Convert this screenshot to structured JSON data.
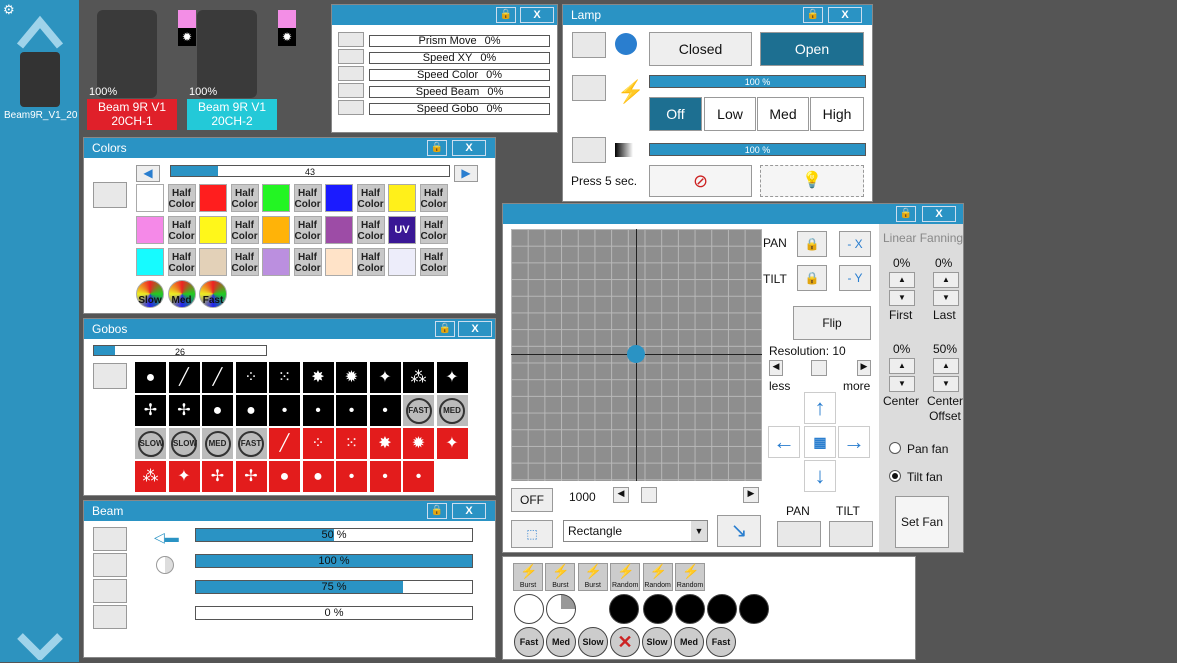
{
  "sidebar": {
    "device_label": "Beam9R_V1_20"
  },
  "fixtures": [
    {
      "name": "Beam 9R V1",
      "mode": "20CH-1",
      "percent": "100%"
    },
    {
      "name": "Beam 9R V1",
      "mode": "20CH-2",
      "percent": "100%"
    }
  ],
  "speeds": {
    "items": [
      {
        "label": "Prism Move",
        "value": "0%"
      },
      {
        "label": "Speed XY",
        "value": "0%"
      },
      {
        "label": "Speed Color",
        "value": "0%"
      },
      {
        "label": "Speed Beam",
        "value": "0%"
      },
      {
        "label": "Speed Gobo",
        "value": "0%"
      }
    ]
  },
  "lamp": {
    "title": "Lamp",
    "closed": "Closed",
    "open": "Open",
    "bar1": "100 %",
    "bar2": "100 %",
    "off": "Off",
    "low": "Low",
    "med": "Med",
    "high": "High",
    "press": "Press 5 sec."
  },
  "colors": {
    "title": "Colors",
    "value": "43",
    "half": "Half Color",
    "uv": "UV",
    "slow": "Slow",
    "med": "Med",
    "fast": "Fast",
    "value_fraction": 0.25
  },
  "gobos": {
    "title": "Gobos",
    "value": "26",
    "value_fraction": 0.12,
    "fast": "FAST",
    "med": "MED",
    "slow": "SLOW"
  },
  "beam": {
    "title": "Beam",
    "bars": [
      {
        "text": "50 %",
        "fraction": 0.5
      },
      {
        "text": "100 %",
        "fraction": 1.0
      },
      {
        "text": "75 %",
        "fraction": 0.75
      },
      {
        "text": "0 %",
        "fraction": 0.0
      }
    ]
  },
  "position": {
    "pan": "PAN",
    "tilt": "TILT",
    "neg_x": "- X",
    "neg_y": "- Y",
    "flip": "Flip",
    "resolution": "Resolution: 10",
    "less": "less",
    "more": "more",
    "off": "OFF",
    "speed_value": "1000",
    "shape": "Rectangle",
    "pan_bottom": "PAN",
    "tilt_bottom": "TILT",
    "linear_fanning": "Linear Fanning",
    "first_val": "0%",
    "last_val": "0%",
    "first": "First",
    "last": "Last",
    "center_val": "0%",
    "offset_val": "50%",
    "center": "Center",
    "center_offset": "Center Offset",
    "pan_fan": "Pan fan",
    "tilt_fan": "Tilt fan",
    "set_fan": "Set Fan"
  },
  "effects": {
    "strobes": [
      "Burst",
      "Burst",
      "Burst",
      "Random",
      "Random",
      "Random"
    ],
    "speeds": [
      "Fast",
      "Med",
      "Slow",
      "",
      "Slow",
      "Med",
      "Fast"
    ]
  }
}
